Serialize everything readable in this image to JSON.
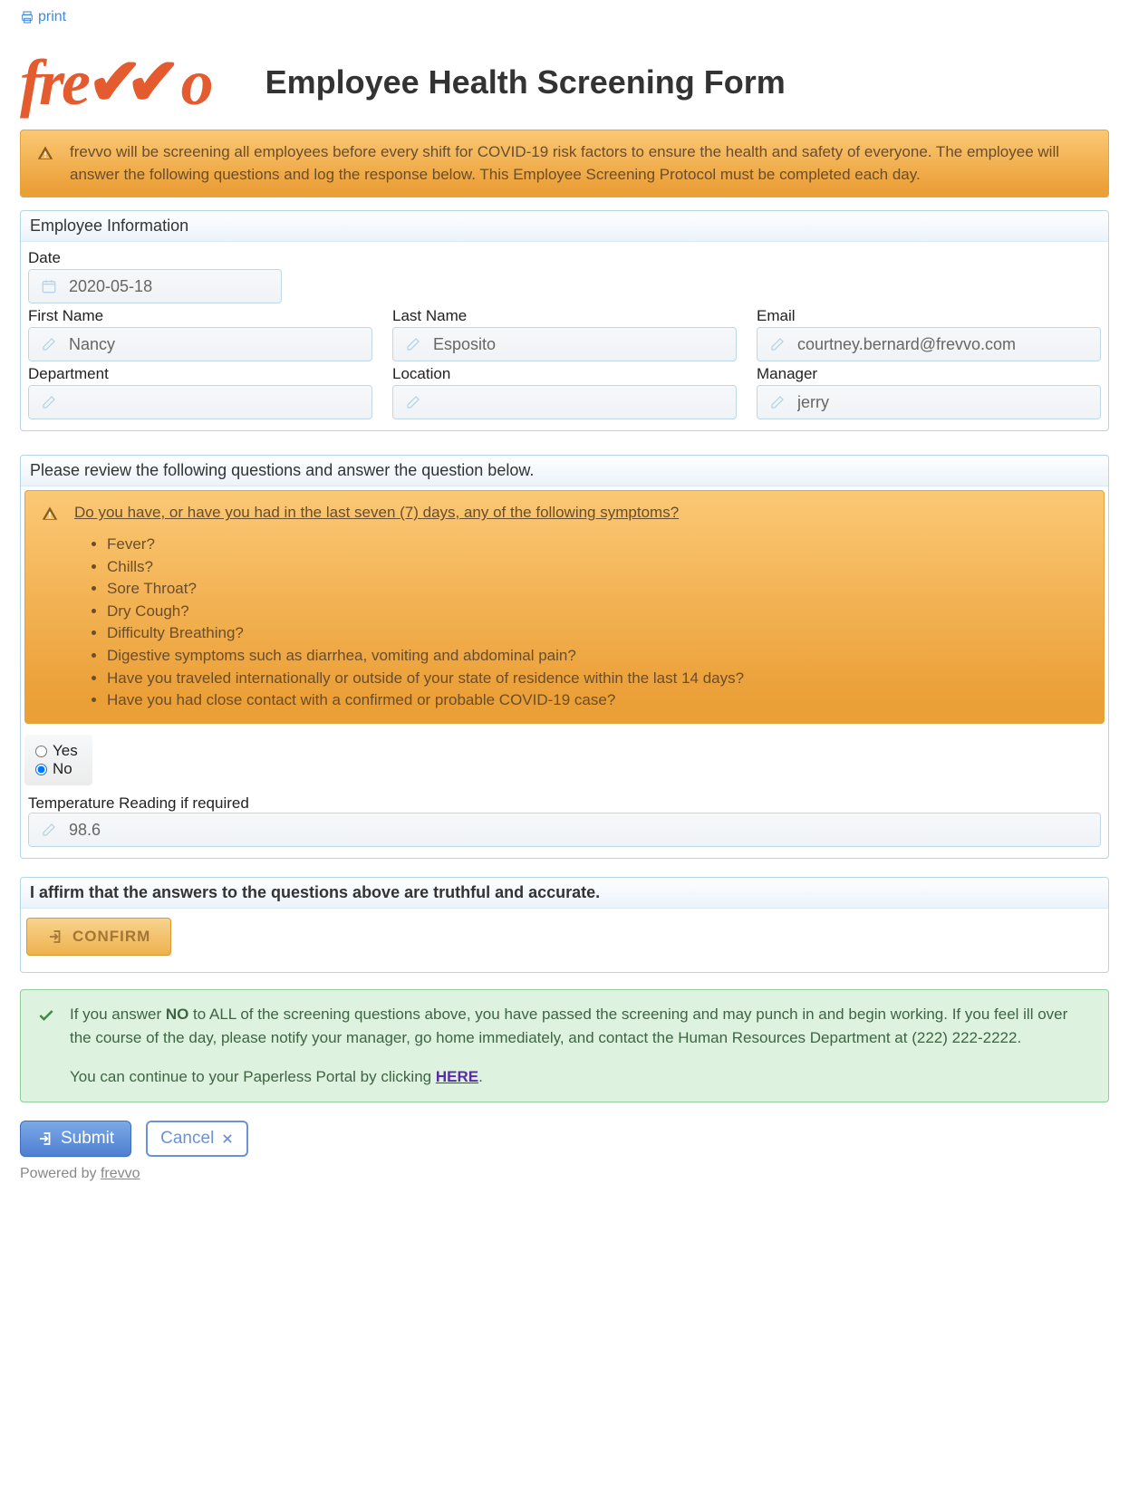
{
  "print_label": "print",
  "logo_text": "frevvo",
  "page_title": "Employee Health Screening Form",
  "intro_alert": "frevvo will be screening all employees before every shift for COVID-19 risk factors to ensure the health and safety of everyone. The employee will answer the following questions and log the response below. This Employee Screening Protocol must be completed each day.",
  "employee_section": {
    "title": "Employee Information",
    "date": {
      "label": "Date",
      "value": "2020-05-18"
    },
    "first_name": {
      "label": "First Name",
      "value": "Nancy"
    },
    "last_name": {
      "label": "Last Name",
      "value": "Esposito"
    },
    "email": {
      "label": "Email",
      "value": "courtney.bernard@frevvo.com"
    },
    "department": {
      "label": "Department",
      "value": ""
    },
    "location": {
      "label": "Location",
      "value": ""
    },
    "manager": {
      "label": "Manager",
      "value": "jerry"
    }
  },
  "questions_section": {
    "title": "Please review the following questions and answer the question below.",
    "heading": "Do you have, or have you had in the last seven (7) days, any of the following symptoms?",
    "items": [
      "Fever?",
      "Chills?",
      "Sore Throat?",
      "Dry Cough?",
      "Difficulty Breathing?",
      "Digestive symptoms such as diarrhea, vomiting and abdominal pain?",
      "Have you traveled internationally or outside of your state of residence within the last 14 days?",
      "Have you had close contact with a confirmed or probable COVID-19 case?"
    ],
    "yes_label": "Yes",
    "no_label": "No",
    "selected": "No",
    "temperature": {
      "label": "Temperature Reading if required",
      "value": "98.6"
    }
  },
  "affirm_section": {
    "title": "I affirm that the answers to the questions above are truthful and accurate.",
    "confirm_label": "CONFIRM"
  },
  "success_message": {
    "pre": "If you answer ",
    "no": "NO",
    "mid": " to ALL of the screening questions above, you have passed the screening and may punch in and begin working. If you feel ill over the course of the day, please notify your manager, go home immediately, and contact the Human Resources Department at (222) 222-2222.",
    "line2_pre": "You can continue to your Paperless Portal by clicking ",
    "here": "HERE",
    "line2_post": "."
  },
  "actions": {
    "submit": "Submit",
    "cancel": "Cancel"
  },
  "footer": {
    "powered": "Powered by ",
    "link": "frevvo"
  }
}
